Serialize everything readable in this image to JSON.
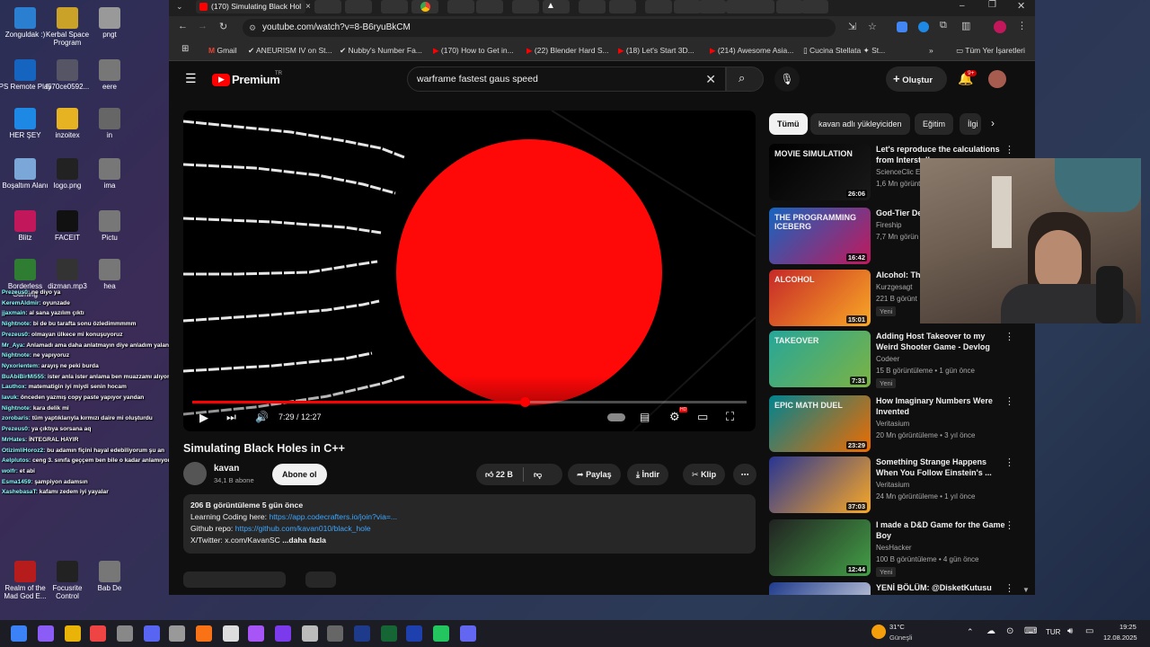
{
  "desktop": {
    "icons": [
      {
        "label": "Zonguldak :)",
        "color": "#2b7fd0"
      },
      {
        "label": "Kerbal Space Program",
        "color": "#c9a227"
      },
      {
        "label": "pngt",
        "color": "#999"
      },
      {
        "label": "PS Remote Play",
        "color": "#1565c0"
      },
      {
        "label": "f570ce0592...",
        "color": "#556"
      },
      {
        "label": "eere",
        "color": "#777"
      },
      {
        "label": "HER ŞEY",
        "color": "#1e88e5"
      },
      {
        "label": "inzoitex",
        "color": "#e6b422"
      },
      {
        "label": "in",
        "color": "#666"
      },
      {
        "label": "Boşaltım Alanı",
        "color": "#7aa7d8"
      },
      {
        "label": "logo.png",
        "color": "#222"
      },
      {
        "label": "ima",
        "color": "#777"
      },
      {
        "label": "Blitz",
        "color": "#c2185b"
      },
      {
        "label": "FACEIT",
        "color": "#111"
      },
      {
        "label": "Pictu",
        "color": "#777"
      },
      {
        "label": "Borderless Gaming",
        "color": "#2e7d32"
      },
      {
        "label": "dizman.mp3",
        "color": "#333"
      },
      {
        "label": "hea",
        "color": "#777"
      },
      {
        "label": "Realm of the Mad God E...",
        "color": "#b71c1c"
      },
      {
        "label": "Focusrite Control",
        "color": "#222"
      },
      {
        "label": "Bab De",
        "color": "#777"
      }
    ],
    "chat": [
      {
        "user": "Prezeus0:",
        "msg": "ne diyo ya"
      },
      {
        "user": "KeremAldmir:",
        "msg": "oyunzade"
      },
      {
        "user": "jjaxmain:",
        "msg": "al sana yazılım çıktı"
      },
      {
        "user": "Nightnote:",
        "msg": "bi de bu tarafta sonu özledimmmmm"
      },
      {
        "user": "Prezeus0:",
        "msg": "olmayan ülkece mi konuşuyoruz"
      },
      {
        "user": "Mr_Aya:",
        "msg": "Anlamadı ama daha anlatmayın diye anladım yalanı"
      },
      {
        "user": "Nightnote:",
        "msg": "ne yapıyoruz"
      },
      {
        "user": "Nyxorientem:",
        "msg": "arayış ne peki burda"
      },
      {
        "user": "BuAbiBirMi555:",
        "msg": "ister anla ister anlama ben muazzamı alıyorum"
      },
      {
        "user": "Lauthox:",
        "msg": "matematigin iyi miydi senin hocam"
      },
      {
        "user": "Iavuk:",
        "msg": "önceden yazmış copy paste yapıyor yandan"
      },
      {
        "user": "Nightnote:",
        "msg": "kara delik mi"
      },
      {
        "user": "zorobaris:",
        "msg": "tüm yaptıklarıyla kırmızı daire mi oluşturdu"
      },
      {
        "user": "Prezeus0:",
        "msg": "ya çıktıya sorsana aq"
      },
      {
        "user": "MrHates:",
        "msg": "İNTEGRAL HAYIR"
      },
      {
        "user": "OtizimliHoroz2:",
        "msg": "bu adamın fiçini hayal edebiliyorum şu an"
      },
      {
        "user": "Aelplutos:",
        "msg": "ceng 3. sınıfa geççem ben bile o kadar anlamıyorum"
      },
      {
        "user": "wolfr:",
        "msg": "et abi"
      },
      {
        "user": "Esma1459:",
        "msg": "şampiyon adamsın"
      },
      {
        "user": "XashebasaT:",
        "msg": "kafamı zedem iyi yayalar"
      }
    ]
  },
  "browser": {
    "active_tab": "(170) Simulating Black Hole",
    "url": "youtube.com/watch?v=8-B6ryuBkCM",
    "bookmarks": [
      "Gmail",
      "ANEURISM IV on St...",
      "Nubby's Number Fa...",
      "(170) How to Get in...",
      "(22) Blender Hard S...",
      "(18) Let's Start 3D...",
      "(214) Awesome Asia...",
      "Cucina Stellata ✦ St...",
      "Tüm Yer İşaretleri"
    ]
  },
  "youtube": {
    "logo": "Premium",
    "region": "TR",
    "search_query": "warframe fastest gaus speed",
    "create_label": "Oluştur",
    "notif_count": "9+",
    "player": {
      "time": "7:29 / 12:27",
      "progress": 0.6,
      "hd": "HD"
    },
    "video_title": "Simulating Black Holes in C++",
    "channel": {
      "name": "kavan",
      "subs": "34,1 B abone",
      "subscribe": "Abone ol"
    },
    "actions": {
      "likes": "22 B",
      "share": "Paylaş",
      "download": "İndir",
      "clip": "Klip"
    },
    "description": {
      "stats": "206 B görüntüleme  5 gün önce",
      "line1_prefix": "Learning Coding here: ",
      "line1_link": "https://app.codecrafters.io/join?via=...",
      "line2_prefix": "Github repo: ",
      "line2_link": "https://github.com/kavan010/black_hole",
      "line3": "X/Twitter: x.com/KavanSC",
      "more": "...daha fazla"
    },
    "chips": [
      "Tümü",
      "kavan adlı yükleyiciden",
      "Eğitim",
      "İlgi"
    ],
    "recommendations": [
      {
        "title": "Let's reproduce the calculations from Interstellar",
        "channel": "ScienceClic En",
        "meta": "1,6 Mn görünt",
        "duration": "26:06",
        "badge": "",
        "thumb_text": "MOVIE  SIMULATION",
        "c1": "#000",
        "c2": "#1a1a1a"
      },
      {
        "title": "God-Tier De",
        "channel": "Fireship",
        "meta": "7,7 Mn görün",
        "duration": "16:42",
        "badge": "",
        "thumb_text": "THE PROGRAMMING ICEBERG",
        "c1": "#1565c0",
        "c2": "#c2185b"
      },
      {
        "title": "Alcohol: The",
        "channel": "Kurzgesagt",
        "meta": "221 B görünt",
        "duration": "15:01",
        "badge": "Yeni",
        "thumb_text": "ALCOHOL",
        "c1": "#c62828",
        "c2": "#f9a825"
      },
      {
        "title": "Adding Host Takeover to my Weird Shooter Game - Devlog",
        "channel": "Codeer",
        "meta": "15 B görüntüleme • 1 gün önce",
        "duration": "7:31",
        "badge": "Yeni",
        "thumb_text": "TAKEOVER",
        "c1": "#26a69a",
        "c2": "#7cb342"
      },
      {
        "title": "How Imaginary Numbers Were Invented",
        "channel": "Veritasium",
        "meta": "20 Mn görüntüleme • 3 yıl önce",
        "duration": "23:29",
        "badge": "",
        "thumb_text": "EPIC MATH DUEL",
        "c1": "#00838f",
        "c2": "#ef6c00"
      },
      {
        "title": "Something Strange Happens When You Follow Einstein's ...",
        "channel": "Veritasium",
        "meta": "24 Mn görüntüleme • 1 yıl önce",
        "duration": "37:03",
        "badge": "",
        "thumb_text": "",
        "c1": "#283593",
        "c2": "#f9a825"
      },
      {
        "title": "I made a D&D Game for the Game Boy",
        "channel": "NesHacker",
        "meta": "100 B görüntüleme • 4 gün önce",
        "duration": "12:44",
        "badge": "Yeni",
        "thumb_text": "",
        "c1": "#212121",
        "c2": "#43a047"
      },
      {
        "title": "YENİ BÖLÜM: @DisketKutusu",
        "channel": "",
        "meta": "",
        "duration": "",
        "badge": "",
        "thumb_text": "",
        "c1": "#1e3a8a",
        "c2": "#e5e7eb"
      }
    ]
  },
  "taskbar": {
    "weather_temp": "31°C",
    "weather_text": "Güneşli",
    "lang": "TUR",
    "time": "19:25",
    "date": "12.08.2025"
  }
}
